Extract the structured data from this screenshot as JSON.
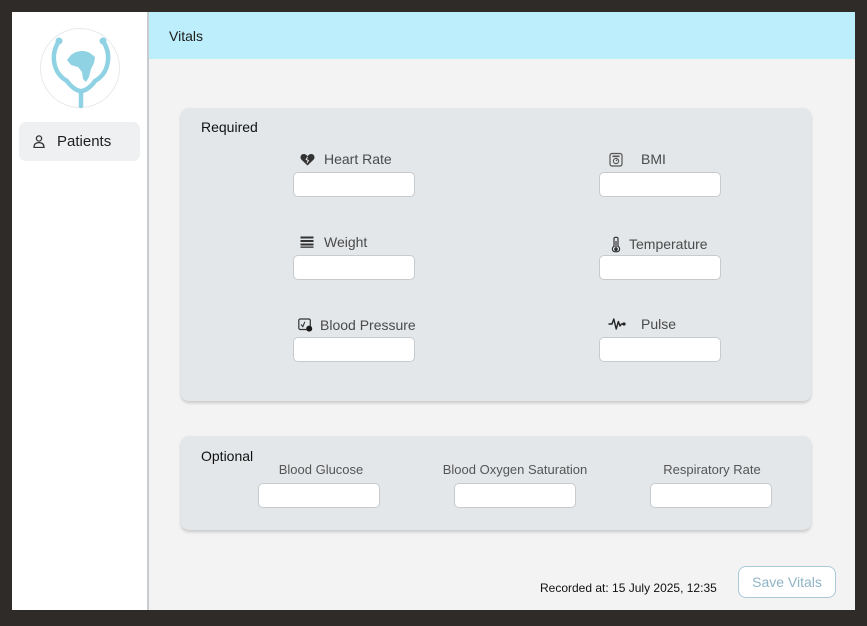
{
  "sidebar": {
    "logo_icon": "stethoscope-africa-logo",
    "items": [
      {
        "label": "Patients",
        "icon": "person-icon"
      }
    ]
  },
  "header": {
    "title": "Vitals"
  },
  "required": {
    "title": "Required",
    "fields": [
      {
        "label": "Heart Rate",
        "icon": "heart-icon",
        "value": ""
      },
      {
        "label": "BMI",
        "icon": "scale-icon",
        "value": ""
      },
      {
        "label": "Weight",
        "icon": "weight-lines-icon",
        "value": ""
      },
      {
        "label": "Temperature",
        "icon": "thermometer-icon",
        "value": ""
      },
      {
        "label": "Blood Pressure",
        "icon": "blood-pressure-icon",
        "value": ""
      },
      {
        "label": "Pulse",
        "icon": "pulse-wave-icon",
        "value": ""
      }
    ]
  },
  "optional": {
    "title": "Optional",
    "fields": [
      {
        "label": "Blood Glucose",
        "value": ""
      },
      {
        "label": "Blood Oxygen Saturation",
        "value": ""
      },
      {
        "label": "Respiratory Rate",
        "value": ""
      }
    ]
  },
  "footer": {
    "recorded": "Recorded at: 15 July 2025, 12:35",
    "save_label": "Save Vitals"
  },
  "colors": {
    "header_bg": "#bdeefb",
    "accent": "#8fb3c6",
    "logo": "#8fd2e3"
  }
}
